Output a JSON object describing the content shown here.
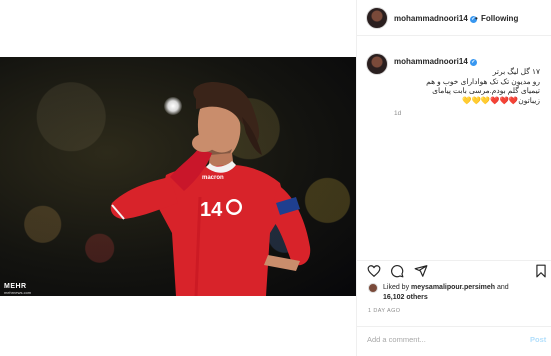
{
  "post": {
    "username": "mohammadnoori14",
    "follow_state": "Following",
    "separator": "•",
    "verified_badge": "verified-icon"
  },
  "media": {
    "watermark": "MEHR",
    "watermark_sub": "mehrnews.com",
    "jersey_number": "14",
    "jersey_brand": "macron"
  },
  "caption": {
    "username": "mohammadnoori14",
    "lines": [
      "۱۷ گل لیگ برتر",
      "رو مدیون تک تک هوادارای خوب و هم",
      "تیمیای گلم بودم.مرسی بابت پیامای",
      "زیباتون❤️❤️❤️💛💛💛"
    ],
    "time": "1d"
  },
  "actions": {
    "like_icon": "heart-icon",
    "comment_icon": "comment-icon",
    "share_icon": "share-icon",
    "save_icon": "bookmark-icon"
  },
  "likes": {
    "prefix": "Liked by ",
    "user": "meysamalipour.persimeh",
    "joiner": " and",
    "others": "16,102 others"
  },
  "timestamp": "1 DAY AGO",
  "comment": {
    "placeholder": "Add a comment...",
    "post_label": "Post"
  },
  "colors": {
    "jersey_red": "#d8232a",
    "verified_blue": "#3897f0",
    "post_disabled": "#b2dffc"
  }
}
